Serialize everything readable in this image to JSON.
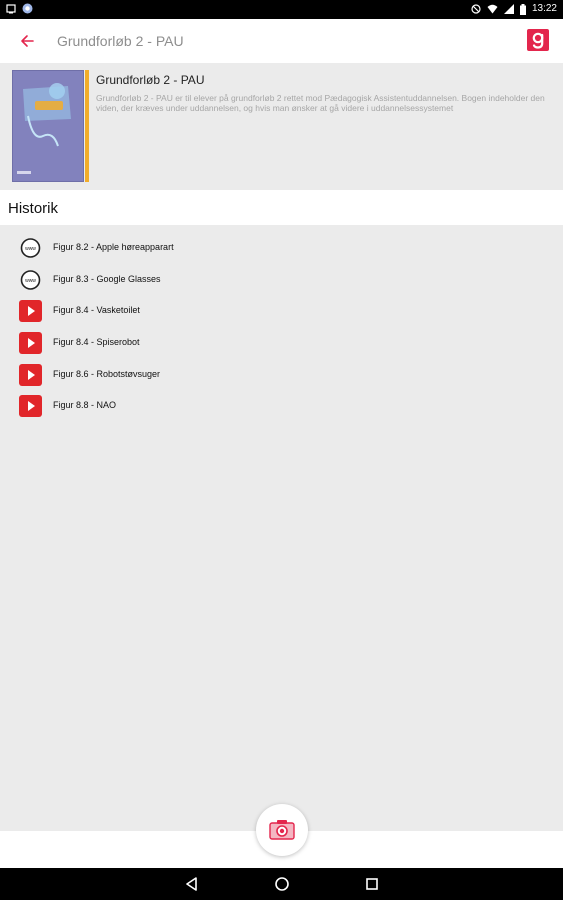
{
  "status_bar": {
    "time": "13:22",
    "icons": [
      "notification-icon",
      "chrome-icon",
      "do-not-disturb-icon",
      "wifi-icon",
      "signal-icon",
      "battery-icon"
    ]
  },
  "app_bar": {
    "title": "Grundforløb 2 - PAU",
    "back_icon": "arrow-left-icon",
    "brand_icon": "g-logo-icon",
    "accent_color": "#e3264d"
  },
  "book": {
    "title": "Grundforløb 2 - PAU",
    "description": "Grundforløb 2 - PAU er til elever på grundforløb 2 rettet mod Pædagogisk Assistentuddannelsen. Bogen indeholder den viden, der kræves under uddannelsen, og hvis man ønsker at gå videre i uddannelsessystemet",
    "cover_color": "#8282bd",
    "strip_color": "#f2ad2a"
  },
  "history": {
    "title": "Historik",
    "items": [
      {
        "label": "Figur 8.2 - Apple høreapparart",
        "icon": "www-icon"
      },
      {
        "label": "Figur 8.3 - Google Glasses",
        "icon": "www-icon"
      },
      {
        "label": "Figur 8.4 - Vasketoilet",
        "icon": "youtube-icon"
      },
      {
        "label": "Figur 8.4 - Spiserobot",
        "icon": "youtube-icon"
      },
      {
        "label": "Figur 8.6 - Robotstøvsuger",
        "icon": "youtube-icon"
      },
      {
        "label": "Figur 8.8 - NAO",
        "icon": "youtube-icon"
      }
    ]
  },
  "fab": {
    "icon": "camera-icon"
  },
  "nav": {
    "icons": [
      "back-triangle-icon",
      "home-circle-icon",
      "recents-square-icon"
    ]
  }
}
